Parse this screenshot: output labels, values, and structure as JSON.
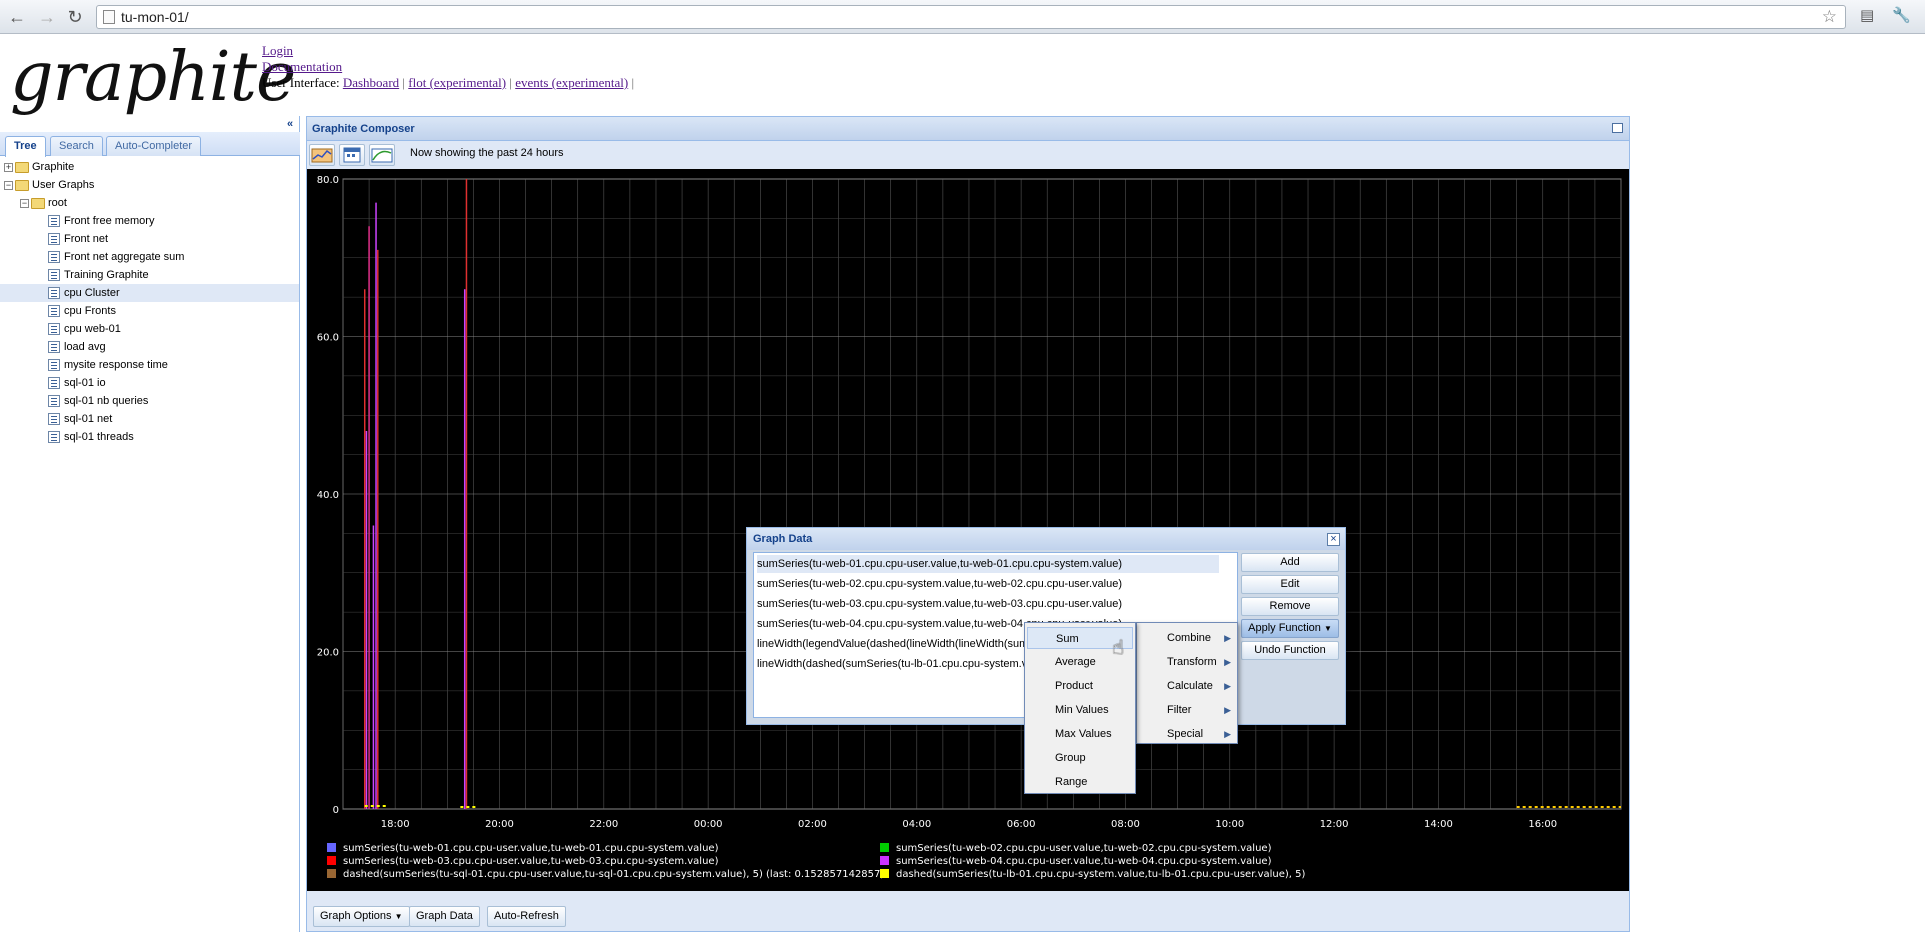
{
  "browser": {
    "url": "tu-mon-01/"
  },
  "header": {
    "logo_text": "graphite",
    "login_label": "Login",
    "documentation_label": "Documentation",
    "ui_label": "User Interface:",
    "dashboard_label": "Dashboard",
    "flot_label": "flot (experimental)",
    "events_label": "events (experimental)",
    "separator": "|"
  },
  "left_panel": {
    "tabs": [
      "Tree",
      "Search",
      "Auto-Completer"
    ],
    "tree": [
      {
        "label": "Graphite",
        "kind": "folder",
        "depth": 0
      },
      {
        "label": "User Graphs",
        "kind": "folder",
        "depth": 0
      },
      {
        "label": "root",
        "kind": "folder",
        "depth": 1
      },
      {
        "label": "Front free memory",
        "kind": "graph",
        "depth": 2
      },
      {
        "label": "Front net",
        "kind": "graph",
        "depth": 2
      },
      {
        "label": "Front net aggregate sum",
        "kind": "graph",
        "depth": 2
      },
      {
        "label": "Training Graphite",
        "kind": "graph",
        "depth": 2
      },
      {
        "label": "cpu Cluster",
        "kind": "graph",
        "depth": 2,
        "selected": true
      },
      {
        "label": "cpu Fronts",
        "kind": "graph",
        "depth": 2
      },
      {
        "label": "cpu web-01",
        "kind": "graph",
        "depth": 2
      },
      {
        "label": "load avg",
        "kind": "graph",
        "depth": 2
      },
      {
        "label": "mysite response time",
        "kind": "graph",
        "depth": 2
      },
      {
        "label": "sql-01 io",
        "kind": "graph",
        "depth": 2
      },
      {
        "label": "sql-01 nb queries",
        "kind": "graph",
        "depth": 2
      },
      {
        "label": "sql-01 net",
        "kind": "graph",
        "depth": 2
      },
      {
        "label": "sql-01 threads",
        "kind": "graph",
        "depth": 2
      }
    ]
  },
  "composer": {
    "title": "Graphite Composer",
    "time_range": "Now showing the past 24 hours",
    "bottom_buttons": [
      "Graph Options",
      "Graph Data",
      "Auto-Refresh"
    ]
  },
  "chart_data": {
    "type": "line",
    "y_ticks": [
      "80.0",
      "60.0",
      "40.0",
      "20.0",
      "0"
    ],
    "ylim": [
      0,
      80
    ],
    "x_ticks": [
      "18:00",
      "20:00",
      "22:00",
      "00:00",
      "02:00",
      "04:00",
      "06:00",
      "08:00",
      "10:00",
      "12:00",
      "14:00",
      "16:00"
    ],
    "grid": true,
    "background": "#000000",
    "spikes": [
      {
        "x": "17:25",
        "value": 66,
        "color": "#e03030"
      },
      {
        "x": "17:27",
        "value": 48,
        "color": "#cc44ff"
      },
      {
        "x": "17:30",
        "value": 74,
        "color": "#e0308a"
      },
      {
        "x": "17:35",
        "value": 36,
        "color": "#cc44ff"
      },
      {
        "x": "17:38",
        "value": 77,
        "color": "#cc44ff"
      },
      {
        "x": "17:40",
        "value": 71,
        "color": "#e03030"
      },
      {
        "x": "19:20",
        "value": 66,
        "color": "#cc44ff"
      },
      {
        "x": "19:22",
        "value": 80,
        "color": "#e03030"
      }
    ],
    "legend": [
      {
        "color": "#6666ff",
        "text": "sumSeries(tu-web-01.cpu.cpu-user.value,tu-web-01.cpu.cpu-system.value)"
      },
      {
        "color": "#00cc00",
        "text": "sumSeries(tu-web-02.cpu.cpu-user.value,tu-web-02.cpu.cpu-system.value)"
      },
      {
        "color": "#ff0000",
        "text": "sumSeries(tu-web-03.cpu.cpu-user.value,tu-web-03.cpu.cpu-system.value)"
      },
      {
        "color": "#cc33ff",
        "text": "sumSeries(tu-web-04.cpu.cpu-user.value,tu-web-04.cpu.cpu-system.value)"
      },
      {
        "color": "#996633",
        "text": "dashed(sumSeries(tu-sql-01.cpu.cpu-user.value,tu-sql-01.cpu.cpu-system.value), 5) (last: 0.152857142857)"
      },
      {
        "color": "#ffff00",
        "text": "dashed(sumSeries(tu-lb-01.cpu.cpu-system.value,tu-lb-01.cpu.cpu-user.value), 5)"
      }
    ]
  },
  "dialog": {
    "title": "Graph Data",
    "targets": [
      "sumSeries(tu-web-01.cpu.cpu-user.value,tu-web-01.cpu.cpu-system.value)",
      "sumSeries(tu-web-02.cpu.cpu-system.value,tu-web-02.cpu.cpu-user.value)",
      "sumSeries(tu-web-03.cpu.cpu-system.value,tu-web-03.cpu.cpu-user.value)",
      "sumSeries(tu-web-04.cpu.cpu-system.value,tu-web-04.cpu.cpu-user.value)",
      "lineWidth(legendValue(dashed(lineWidth(lineWidth(sumSeries(tu-sql-01.cpu.cpu-user.value,tu-sql-01.cpu.cpu-system.value),5),5),5),'last'),5)",
      "lineWidth(dashed(sumSeries(tu-lb-01.cpu.cpu-system.value,tu-lb-01.cpu.cpu-user.value),5),5)"
    ],
    "buttons": {
      "add": "Add",
      "edit": "Edit",
      "remove": "Remove",
      "apply_function": "Apply Function",
      "undo_function": "Undo Function"
    }
  },
  "function_menu": [
    "Combine",
    "Transform",
    "Calculate",
    "Filter",
    "Special"
  ],
  "combine_menu": [
    "Sum",
    "Average",
    "Product",
    "Min Values",
    "Max Values",
    "Group",
    "Range"
  ]
}
